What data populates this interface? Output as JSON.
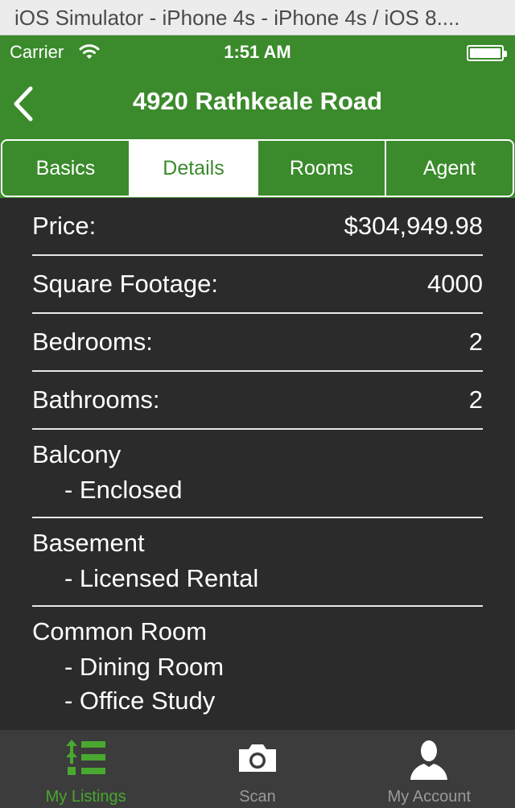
{
  "simulator": {
    "title": "iOS Simulator - iPhone 4s - iPhone 4s / iOS 8...."
  },
  "status_bar": {
    "carrier": "Carrier",
    "time": "1:51 AM",
    "wifi_icon": "wifi-icon",
    "battery_icon": "battery-icon"
  },
  "nav": {
    "title": "4920 Rathkeale Road",
    "back_icon": "chevron-left-icon"
  },
  "segments": [
    {
      "label": "Basics",
      "active": false
    },
    {
      "label": "Details",
      "active": true
    },
    {
      "label": "Rooms",
      "active": false
    },
    {
      "label": "Agent",
      "active": false
    }
  ],
  "details": {
    "price": {
      "label": "Price:",
      "value": "$304,949.98"
    },
    "square_footage": {
      "label": "Square Footage:",
      "value": "4000"
    },
    "bedrooms": {
      "label": "Bedrooms:",
      "value": "2"
    },
    "bathrooms": {
      "label": "Bathrooms:",
      "value": "2"
    }
  },
  "groups": {
    "balcony": {
      "title": "Balcony",
      "items": [
        "- Enclosed"
      ]
    },
    "basement": {
      "title": "Basement",
      "items": [
        "- Licensed Rental"
      ]
    },
    "common_room": {
      "title": "Common Room",
      "items": [
        "- Dining Room",
        "- Office Study"
      ]
    }
  },
  "tabs": [
    {
      "label": "My Listings",
      "icon": "listings-icon",
      "active": true
    },
    {
      "label": "Scan",
      "icon": "camera-icon",
      "active": false
    },
    {
      "label": "My Account",
      "icon": "person-icon",
      "active": false
    }
  ],
  "colors": {
    "brand_green": "#3b8a2c",
    "active_tab": "#49a82f",
    "background": "#2b2b2b"
  }
}
